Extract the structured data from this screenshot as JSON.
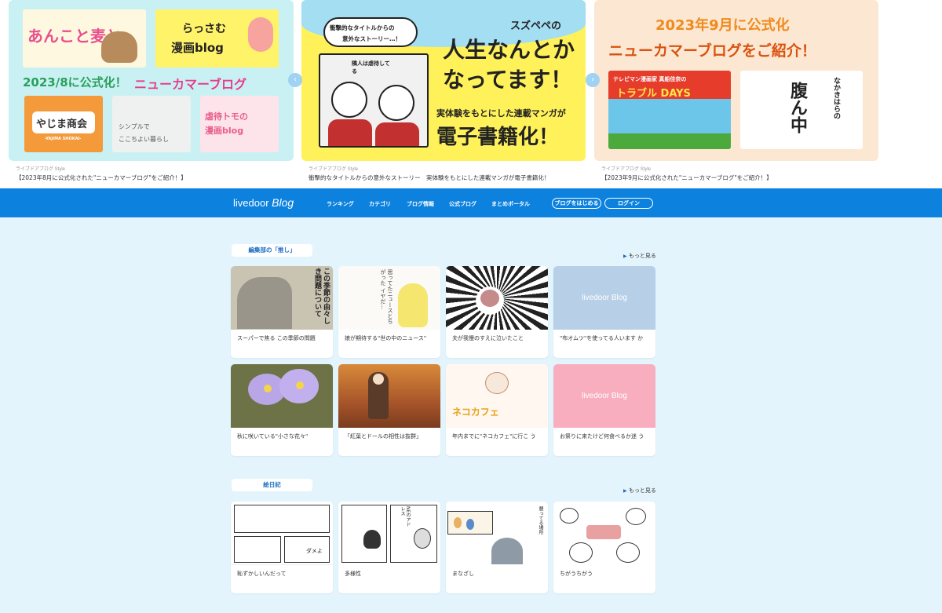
{
  "carousel": {
    "slides": [
      {
        "source": "ライブドアブログ Style",
        "caption": "【2023年8月に公式化された\"ニューカマーブログ\"をご紹介！】",
        "headline_date": "2023/8に公式化！",
        "headline_main": "ニューカマーブログ",
        "panel_a": "あんこと麦と",
        "panel_b_line1": "らっさむ",
        "panel_b_line2": "漫画blog",
        "panel_c": "やじま商会",
        "panel_c_sub": "-YAJIMA SHOKAI-",
        "panel_d_line1": "シンプルで",
        "panel_d_line2": "ここちよい暮らし",
        "panel_e_line1": "虐待トモの",
        "panel_e_line2": "漫画blog"
      },
      {
        "source": "ライブドアブログ Style",
        "caption": "衝撃的なタイトルからの意外なストーリー　実体験をもとにした連載マンガが電子書籍化！",
        "bubble_line1": "衝撃的なタイトルからの",
        "bubble_line2": "意外なストーリー…！",
        "title_small": "スズペペの",
        "title_line1": "人生なんとか",
        "title_line2": "なってます！",
        "sub": "実体験をもとにした連載マンガが",
        "big": "電子書籍化！",
        "manga_text": "隣人は虐待してる"
      },
      {
        "source": "ライブドアブログ Style",
        "caption": "【2023年9月に公式化された\"ニューカマーブログ\"をご紹介！】",
        "headline_date": "2023年9月に公式化",
        "headline_main": "ニューカマーブログをご紹介！",
        "panel_a_line1": "テレビマン漫画家 真船佳奈の",
        "panel_a_line2": "トラブル DAYS",
        "panel_b_small": "なかきはらの",
        "panel_b_big": "腹ん中"
      }
    ],
    "prev_label": "‹",
    "next_label": "›"
  },
  "nav": {
    "logo_text": "livedoor",
    "logo_italic": "Blog",
    "items": [
      "ランキング",
      "カテゴリ",
      "ブログ情報",
      "公式ブログ",
      "まとめポータル"
    ],
    "start_button": "ブログをはじめる",
    "login_button": "ログイン"
  },
  "sections": [
    {
      "label": "編集部の「推し」",
      "more": "もっと見る",
      "cards": [
        {
          "title": "スーパーで焦る この季節の問題",
          "thumb_text": "この季節の由々しき問題について"
        },
        {
          "title": "娘が期待する\"世の中のニュース\"",
          "thumb_text": "思ってたニュースとちがった イヤだ…"
        },
        {
          "title": "夫が我慢のすえに泣いたこと",
          "thumb_text": ""
        },
        {
          "title": "\"布オムツ\"を使ってる人います か",
          "thumb_text": "livedoor Blog"
        },
        {
          "title": "秋に咲いている\"小さな花々\"",
          "thumb_text": ""
        },
        {
          "title": "「紅葉とドールの相性は抜群」",
          "thumb_text": ""
        },
        {
          "title": "年内までに\"ネコカフェ\"に行こ う",
          "thumb_text": "ネコカフェ"
        },
        {
          "title": "お祭りに来たけど何食べるか迷 う",
          "thumb_text": "livedoor Blog"
        }
      ]
    },
    {
      "label": "絵日記",
      "more": "もっと見る",
      "cards": [
        {
          "title": "恥ずかしいんだって",
          "thumb_text": "ダメよ"
        },
        {
          "title": "多様性",
          "thumb_text": "NEのアドレス"
        },
        {
          "title": "まなざし",
          "thumb_text": "憩ってる場所"
        },
        {
          "title": "ちがうちがう",
          "thumb_text": ""
        }
      ]
    }
  ],
  "colors": {
    "nav": "#0c82de",
    "page_bg": "#e3f4fd",
    "accent_pink": "#e83c8c",
    "accent_orange": "#f08a1d",
    "section_label": "#1a6fc4",
    "placeholder_blue": "#b8cfe8",
    "placeholder_pink": "#f9aec0"
  }
}
